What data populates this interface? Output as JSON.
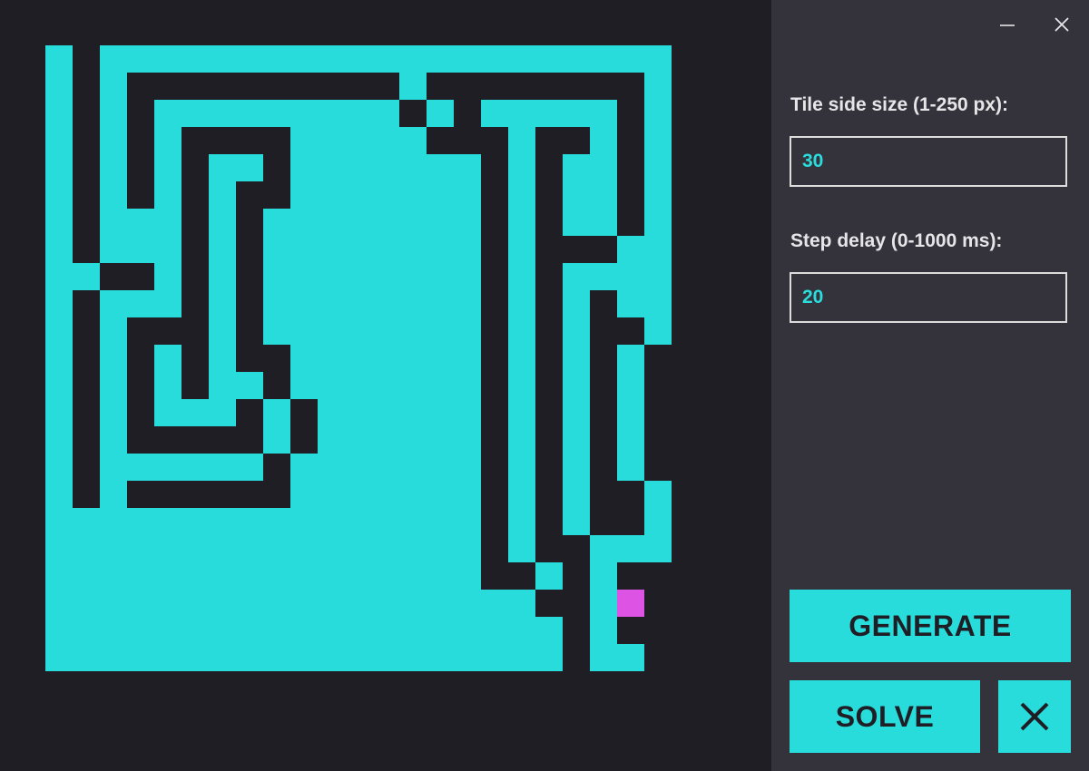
{
  "colors": {
    "maze_path": "#29dcdc",
    "maze_wall": "#1f1e25",
    "cursor_tile": "#dd53e3",
    "panel_bg": "#34333b",
    "accent": "#29dcdc"
  },
  "window": {
    "minimize_icon": "minimize-icon",
    "close_icon": "close-icon"
  },
  "settings": {
    "tile_size_label": "Tile side size (1-250 px):",
    "tile_size_value": "30",
    "step_delay_label": "Step delay (0-1000 ms):",
    "step_delay_value": "20"
  },
  "buttons": {
    "generate_label": "GENERATE",
    "solve_label": "SOLVE",
    "clear_icon": "x-icon"
  },
  "maze": {
    "columns": 25,
    "rows": 25,
    "cursor_cell": [
      22,
      21
    ],
    "grid": [
      "#########################",
      "#.#.....................#",
      "#.#.##########.########.#",
      "#.#.#.........#.#.....#.#",
      "#.#.#.####.....###.##.#.#",
      "#.#.#.#..#.......#.#..#.#",
      "#.#.#.#.##.......#.#..#.#",
      "#.#...#.#........#.#..#.#",
      "#.#...#.#........#.###..#",
      "#..##.#.#........#.#....#",
      "#.#...#.#........#.#.#..#",
      "#.#.###.#........#.#.##.#",
      "#.#.#.#.##.......#.#.#.##",
      "#.#.#.#..#.......#.#.#.##",
      "#.#.#...#.#......#.#.#.##",
      "#.#.#####.#......#.#.#.##",
      "#.#......#.......#.#.#.##",
      "#.#.######.......#.#.##.#",
      "#................#.#.##.#",
      "#................#.##...#",
      "#................##.#.###",
      "#..................##..##",
      "#...................#.###",
      "#...................#..##",
      "#########################"
    ]
  }
}
